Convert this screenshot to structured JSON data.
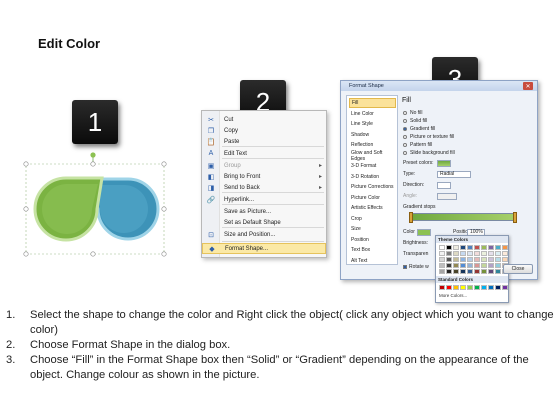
{
  "title": "Edit Color",
  "steps": [
    "1",
    "2",
    "3"
  ],
  "context_menu": {
    "items": [
      {
        "label": "Cut",
        "icon": "scissors-icon",
        "glyph": "✂",
        "arrow": false,
        "disabled": false
      },
      {
        "label": "Copy",
        "icon": "copy-icon",
        "glyph": "❐",
        "arrow": false,
        "disabled": false
      },
      {
        "label": "Paste",
        "icon": "paste-icon",
        "glyph": "📋",
        "arrow": false,
        "disabled": false
      },
      {
        "label": "Edit Text",
        "icon": "edit-text-icon",
        "glyph": "A",
        "arrow": false,
        "disabled": false
      },
      {
        "label": "Group",
        "icon": "group-icon",
        "glyph": "▣",
        "arrow": true,
        "disabled": true
      },
      {
        "label": "Bring to Front",
        "icon": "bring-front-icon",
        "glyph": "◧",
        "arrow": true,
        "disabled": false
      },
      {
        "label": "Send to Back",
        "icon": "send-back-icon",
        "glyph": "◨",
        "arrow": true,
        "disabled": false
      },
      {
        "label": "Hyperlink...",
        "icon": "hyperlink-icon",
        "glyph": "🔗",
        "arrow": false,
        "disabled": false
      },
      {
        "label": "Save as Picture...",
        "icon": "",
        "glyph": "",
        "arrow": false,
        "disabled": false
      },
      {
        "label": "Set as Default Shape",
        "icon": "",
        "glyph": "",
        "arrow": false,
        "disabled": false
      },
      {
        "label": "Size and Position...",
        "icon": "size-position-icon",
        "glyph": "⊡",
        "arrow": false,
        "disabled": false
      },
      {
        "label": "Format Shape...",
        "icon": "format-shape-icon",
        "glyph": "◆",
        "arrow": false,
        "disabled": false,
        "highlighted": true
      }
    ]
  },
  "dialog": {
    "title": "Format Shape",
    "close_glyph": "✕",
    "sidebar": [
      "Fill",
      "Line Color",
      "Line Style",
      "Shadow",
      "Reflection",
      "Glow and Soft Edges",
      "3-D Format",
      "3-D Rotation",
      "Picture Corrections",
      "Picture Color",
      "Artistic Effects",
      "Crop",
      "Size",
      "Position",
      "Text Box",
      "Alt Text"
    ],
    "heading": "Fill",
    "fill_options": [
      "No fill",
      "Solid fill",
      "Gradient fill",
      "Picture or texture fill",
      "Pattern fill",
      "Slide background fill"
    ],
    "selected_fill": "Gradient fill",
    "preset_colors_label": "Preset colors:",
    "type_label": "Type:",
    "type_value": "Radial",
    "direction_label": "Direction:",
    "angle_label": "Angle:",
    "gradient_stops_label": "Gradient stops",
    "color_label": "Color",
    "position_label": "Position:",
    "position_value": "100%",
    "brightness_label": "Brightness:",
    "transparency_label": "Transparen",
    "rotate_label": "Rotate w",
    "close_button": "Close",
    "popup": {
      "theme_label": "Theme Colors",
      "standard_label": "Standard Colors",
      "more_label": "More Colors...",
      "theme_colors": [
        "#ffffff",
        "#000000",
        "#eeece1",
        "#1f497d",
        "#4f81bd",
        "#c0504d",
        "#9bbb59",
        "#8064a2",
        "#4bacc6",
        "#f79646",
        "#f2f2f2",
        "#7f7f7f",
        "#ddd9c3",
        "#c6d9f0",
        "#dbe5f1",
        "#f2dcdb",
        "#ebf1dd",
        "#e5e0ec",
        "#dbeef3",
        "#fdeada",
        "#d8d8d8",
        "#595959",
        "#c4bd97",
        "#8db3e2",
        "#b8cce4",
        "#e5b9b7",
        "#d7e3bc",
        "#ccc1d9",
        "#b7dde8",
        "#fbd5b5",
        "#bfbfbf",
        "#3f3f3f",
        "#938953",
        "#548dd4",
        "#95b3d7",
        "#d99694",
        "#c3d69b",
        "#b2a2c7",
        "#92cddc",
        "#fac08f",
        "#a5a5a5",
        "#262626",
        "#494429",
        "#17365d",
        "#366092",
        "#953734",
        "#76923c",
        "#5f497a",
        "#31859b",
        "#e36c09"
      ],
      "standard_colors": [
        "#c00000",
        "#ff0000",
        "#ffc000",
        "#ffff00",
        "#92d050",
        "#00b050",
        "#00b0f0",
        "#0070c0",
        "#002060",
        "#7030a0"
      ]
    }
  },
  "shapes": {
    "green": "#7bb342",
    "blue": "#3d93b8"
  },
  "instructions": [
    {
      "num": "1.",
      "text": "Select the shape to change the color and Right click the object( click any object which you want to change color)"
    },
    {
      "num": "2.",
      "text": "Choose Format Shape in the dialog box."
    },
    {
      "num": "3.",
      "text": "Choose “Fill” in the Format Shape box then “Solid” or “Gradient” depending on the appearance of the object. Change colour as shown in the picture."
    }
  ]
}
